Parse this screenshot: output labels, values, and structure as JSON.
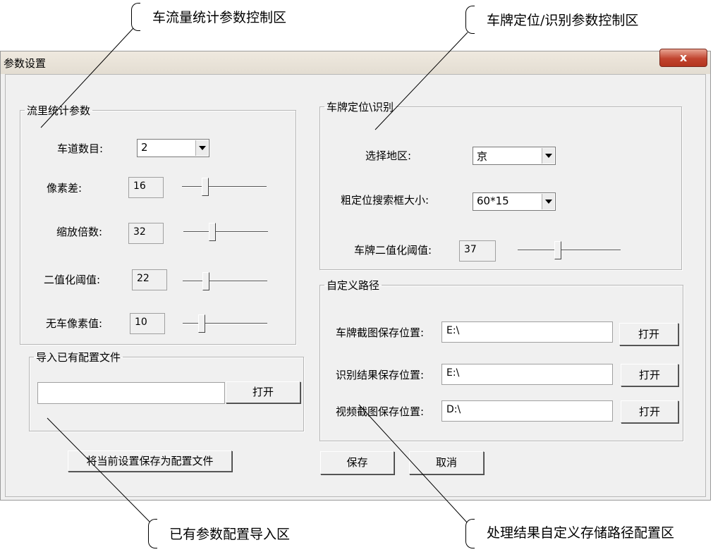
{
  "window": {
    "title": "参数设置",
    "close_label": "x"
  },
  "annotations": {
    "flow": "车流量统计参数控制区",
    "plate": "车牌定位/识别参数控制区",
    "import": "已有参数配置导入区",
    "path": "处理结果自定义存储路径配置区"
  },
  "flow": {
    "legend": "流里统计参数",
    "lanes": {
      "label": "车道数目:",
      "value": "2"
    },
    "pixel_diff": {
      "label": "像素差:",
      "value": "16",
      "level": 0.25
    },
    "zoom": {
      "label": "缩放倍数:",
      "value": "32",
      "level": 0.33
    },
    "binary": {
      "label": "二值化阈值:",
      "value": "22",
      "level": 0.25
    },
    "empty": {
      "label": "无车像素值:",
      "value": "10",
      "level": 0.2
    }
  },
  "import_cfg": {
    "legend": "导入已有配置文件",
    "path_value": "",
    "open_label": "打开"
  },
  "save_as_label": "将当前设置保存为配置文件",
  "plate": {
    "legend": "车牌定位\\识别",
    "region": {
      "label": "选择地区:",
      "value": "京"
    },
    "search_size": {
      "label": "粗定位搜索框大小:",
      "value": "60*15"
    },
    "binary": {
      "label": "车牌二值化阈值:",
      "value": "37",
      "level": 0.38
    }
  },
  "paths": {
    "legend": "自定义路径",
    "plate_crop": {
      "label": "车牌截图保存位置:",
      "value": "E:\\",
      "open_label": "打开"
    },
    "result": {
      "label": "识别结果保存位置:",
      "value": "E:\\",
      "open_label": "打开"
    },
    "video_crop": {
      "label": "视频截图保存位置:",
      "value": "D:\\",
      "open_label": "打开"
    }
  },
  "buttons": {
    "save": "保存",
    "cancel": "取消"
  }
}
